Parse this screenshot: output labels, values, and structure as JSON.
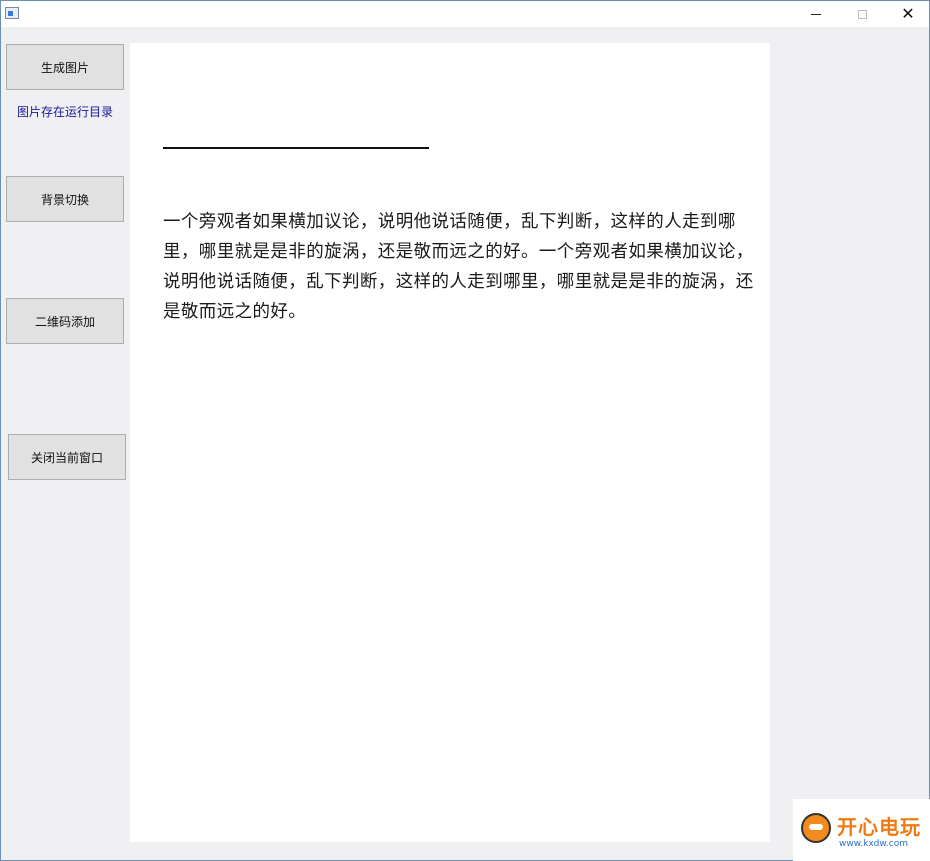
{
  "window": {
    "controls": {
      "minimize_icon": "minimize-icon",
      "maximize_icon": "maximize-icon",
      "close_glyph": "✕"
    }
  },
  "sidebar": {
    "generate_label": "生成图片",
    "hint": "图片存在运行目录",
    "background_label": "背景切换",
    "qrcode_label": "二维码添加",
    "close_label": "关闭当前窗口"
  },
  "canvas": {
    "body_text": "一个旁观者如果横加议论，说明他说话随便，乱下判断，这样的人走到哪里，哪里就是是非的旋涡，还是敬而远之的好。一个旁观者如果横加议论，说明他说话随便，乱下判断，这样的人走到哪里，哪里就是是非的旋涡，还是敬而远之的好。"
  },
  "watermark": {
    "brand": "开心电玩",
    "url": "www.kxdw.com"
  },
  "colors": {
    "window_bg": "#f0eff2",
    "button_bg": "#e1e1e1",
    "hint_text": "#1a1a9a",
    "canvas_bg": "#ffffff"
  }
}
